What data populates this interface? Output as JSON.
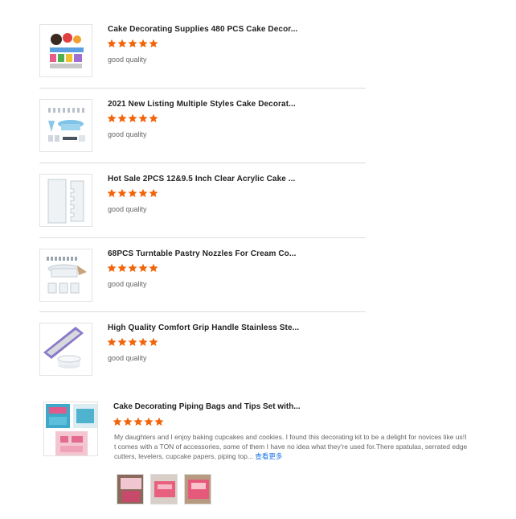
{
  "reviews": [
    {
      "title": "Cake Decorating Supplies 480 PCS Cake Decor...",
      "rating": 5,
      "comment": "good quality",
      "image": "cake-supplies-kit-image"
    },
    {
      "title": "2021 New Listing Multiple Styles Cake Decorat...",
      "rating": 5,
      "comment": "good quality",
      "image": "turntable-tools-set-image"
    },
    {
      "title": "Hot Sale 2PCS 12&9.5 Inch Clear Acrylic Cake ...",
      "rating": 5,
      "comment": "good quality",
      "image": "acrylic-scraper-image"
    },
    {
      "title": "68PCS Turntable Pastry Nozzles For Cream Co...",
      "rating": 5,
      "comment": "good quality",
      "image": "pastry-nozzles-image"
    },
    {
      "title": "High Quality Comfort Grip Handle Stainless Ste...",
      "rating": 5,
      "comment": "good quality",
      "image": "spatula-image"
    }
  ],
  "featured_review": {
    "title": "Cake Decorating Piping Bags and Tips Set with...",
    "rating": 5,
    "text": "My daughters and I enjoy baking cupcakes and cookies. I found this decorating kit to be a delight for novices like us!It comes with a TON of accessories, some of them I have no idea what they're used for.There spatulas, serrated edge cutters, levelers, cupcake papers, piping top...",
    "more_link": "查看更多",
    "photo_count": 3
  },
  "colors": {
    "star": "#f2640a",
    "link": "#1a73e8",
    "divider": "#dcdcdc"
  }
}
